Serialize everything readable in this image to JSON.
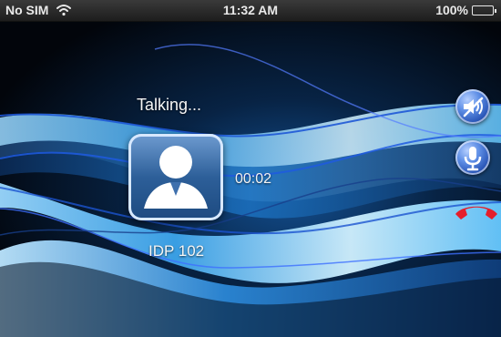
{
  "status_bar": {
    "carrier": "No SIM",
    "time": "11:32 AM",
    "battery": "100%",
    "battery_level": 1
  },
  "call": {
    "status": "Talking...",
    "timer": "00:02",
    "contact": "IDP 102"
  },
  "controls": {
    "speaker_icon": "speaker-muted-icon",
    "mic_icon": "microphone-icon",
    "end_icon": "hang-up-phone-icon"
  },
  "colors": {
    "status_bar": "#2a2a2a",
    "wallpaper_base": "#03070f",
    "wave_light": "#9ad8ff",
    "wave_blue": "#2f7fd1",
    "control_blue": "#3b6fd0",
    "end_call_red": "#e51e2b"
  }
}
